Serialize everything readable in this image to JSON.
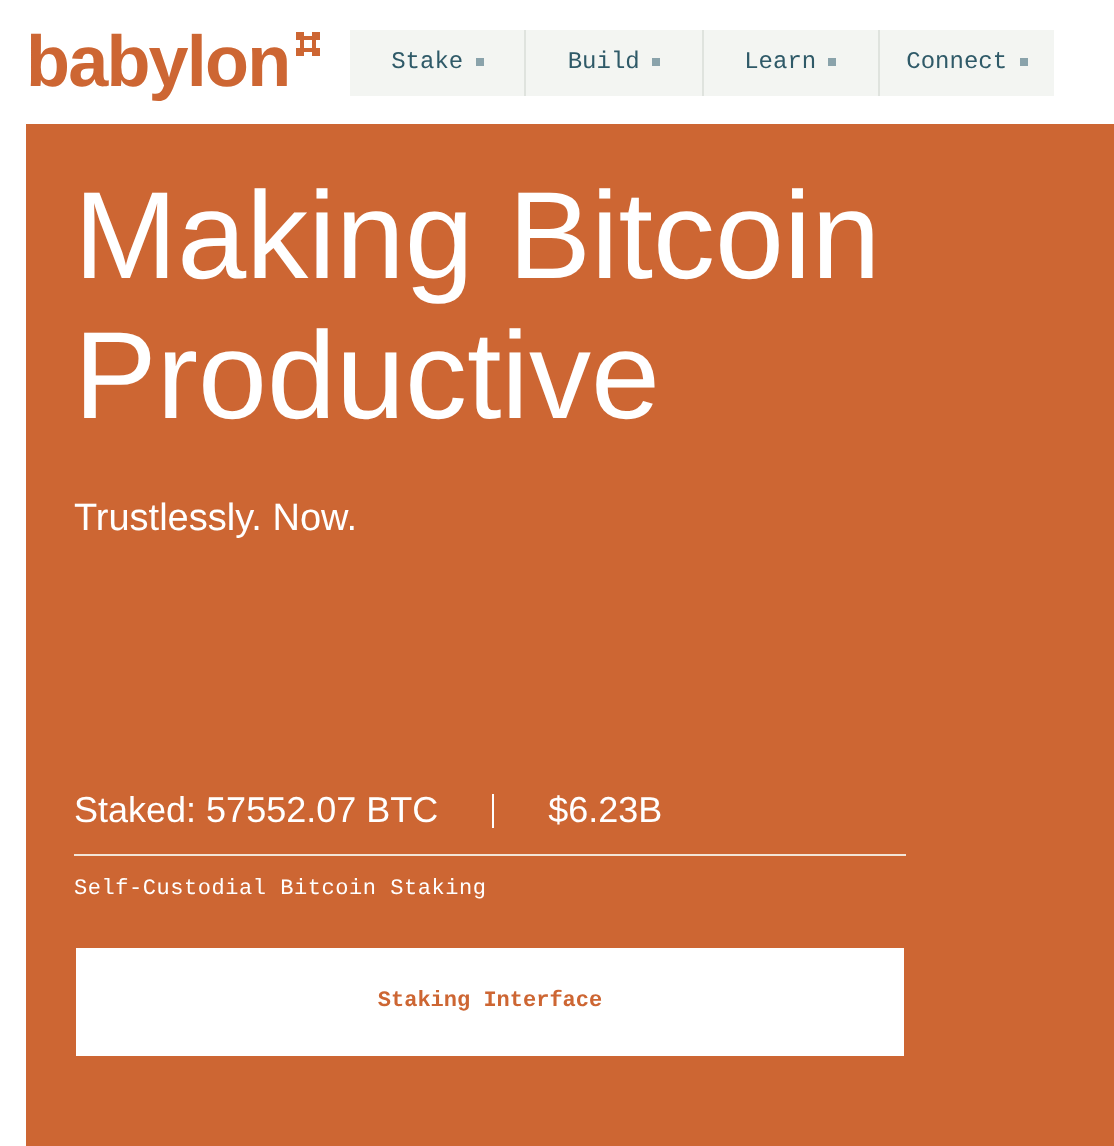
{
  "logo": {
    "text": "babylon"
  },
  "nav": [
    {
      "label": "Stake"
    },
    {
      "label": "Build"
    },
    {
      "label": "Learn"
    },
    {
      "label": "Connect"
    }
  ],
  "hero": {
    "title_lines": [
      "Making Bitcoin",
      "Productive"
    ],
    "subtitle": "Trustlessly. Now.",
    "staked": "Staked: 57552.07 BTC",
    "value": "$6.23B",
    "caption": "Self-Custodial Bitcoin Staking",
    "button": "Staking Interface"
  }
}
